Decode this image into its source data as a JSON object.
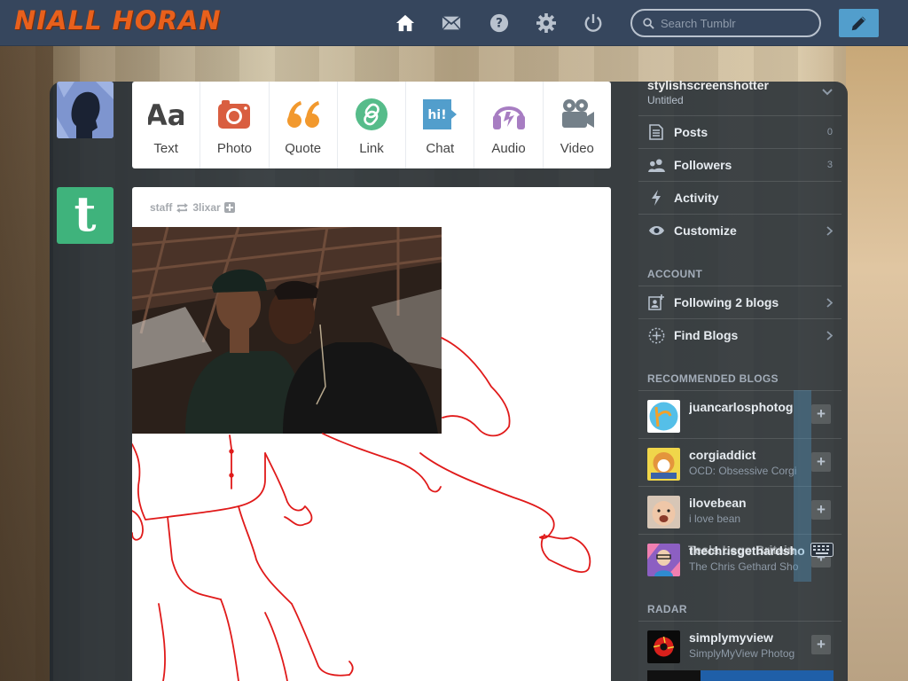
{
  "logo": {
    "text": "NIALL HORAN"
  },
  "nav": {
    "icons": [
      "home-icon",
      "mail-icon",
      "help-icon",
      "settings-icon",
      "power-icon"
    ],
    "search_placeholder": "Search Tumblr",
    "compose_icon": "pencil-icon"
  },
  "post_types": [
    {
      "label": "Text",
      "icon": "text-icon",
      "color": "#444444"
    },
    {
      "label": "Photo",
      "icon": "camera-icon",
      "color": "#d95e40"
    },
    {
      "label": "Quote",
      "icon": "quote-icon",
      "color": "#f2992e"
    },
    {
      "label": "Link",
      "icon": "link-icon",
      "color": "#56bc8a"
    },
    {
      "label": "Chat",
      "icon": "chat-icon",
      "color": "#529ecc"
    },
    {
      "label": "Audio",
      "icon": "headphones-icon",
      "color": "#a77dc2"
    },
    {
      "label": "Video",
      "icon": "video-camera-icon",
      "color": "#748089"
    }
  ],
  "post": {
    "author": "staff",
    "reblogged_from": "3lixar"
  },
  "sidebar": {
    "account_name": "stylishscreenshotter",
    "account_subtitle": "Untitled",
    "blog_items": [
      {
        "label": "Posts",
        "count": "0",
        "icon": "posts-icon"
      },
      {
        "label": "Followers",
        "count": "3",
        "icon": "followers-icon"
      },
      {
        "label": "Activity",
        "count": "",
        "icon": "activity-icon"
      },
      {
        "label": "Customize",
        "count": "",
        "icon": "eye-icon"
      }
    ],
    "account_heading": "ACCOUNT",
    "account_items": [
      {
        "label": "Following 2 blogs",
        "icon": "following-icon"
      },
      {
        "label": "Find Blogs",
        "icon": "find-blogs-icon"
      }
    ],
    "recommended_heading": "RECOMMENDED BLOGS",
    "recommended": [
      {
        "name": "juancarlosphotog",
        "desc": ""
      },
      {
        "name": "corgiaddict",
        "desc": "OCD: Obsessive Corgi"
      },
      {
        "name": "ilovebean",
        "desc": "i love bean"
      },
      {
        "name": "thechrisgethardsho",
        "desc": "The Chris Gethard Sho"
      }
    ],
    "radar_heading": "RADAR",
    "radar": [
      {
        "name": "simplymyview",
        "desc": "SimplyMyView Photog"
      }
    ],
    "overlay_text": "Tesla   Lego   Britain"
  }
}
